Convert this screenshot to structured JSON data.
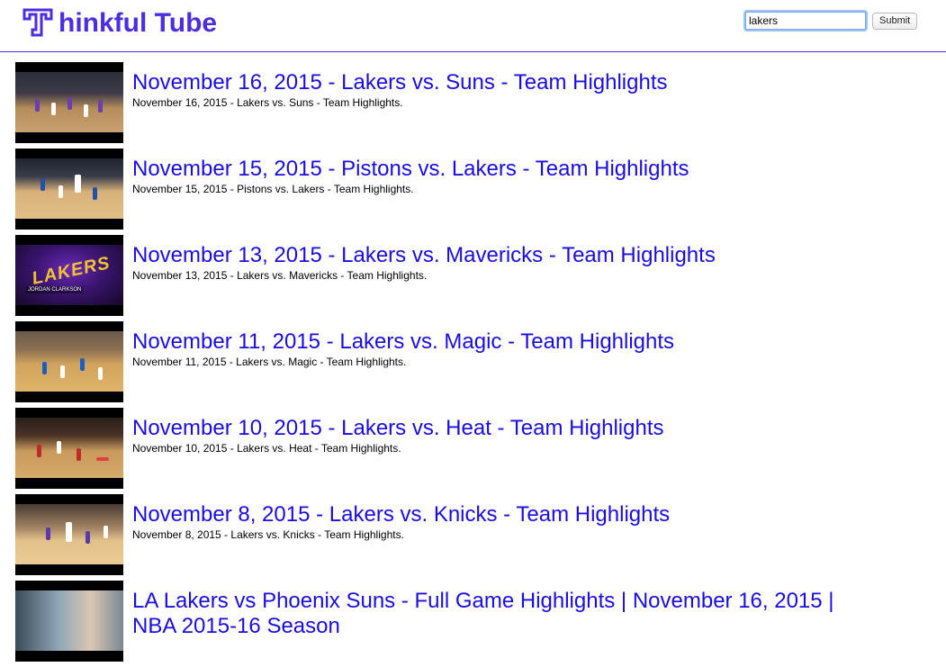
{
  "header": {
    "brand": "hinkful Tube",
    "logo_icon": "thinkful-t-logo-icon",
    "accent_color": "#4a2ee0"
  },
  "search": {
    "value": "lakers",
    "placeholder": "",
    "submit_label": "Submit"
  },
  "results": [
    {
      "title": "November 16, 2015 - Lakers vs. Suns - Team Highlights",
      "description": "November 16, 2015 - Lakers vs. Suns - Team Highlights."
    },
    {
      "title": "November 15, 2015 - Pistons vs. Lakers - Team Highlights",
      "description": "November 15, 2015 - Pistons vs. Lakers - Team Highlights."
    },
    {
      "title": "November 13, 2015 - Lakers vs. Mavericks - Team Highlights",
      "description": "November 13, 2015 - Lakers vs. Mavericks - Team Highlights.",
      "thumb_text": "LAKERS",
      "thumb_caption": "JORDAN CLARKSON"
    },
    {
      "title": "November 11, 2015 - Lakers vs. Magic - Team Highlights",
      "description": "November 11, 2015 - Lakers vs. Magic - Team Highlights."
    },
    {
      "title": "November 10, 2015 - Lakers vs. Heat - Team Highlights",
      "description": "November 10, 2015 - Lakers vs. Heat - Team Highlights."
    },
    {
      "title": "November 8, 2015 - Lakers vs. Knicks - Team Highlights",
      "description": "November 8, 2015 - Lakers vs. Knicks - Team Highlights."
    },
    {
      "title": "LA Lakers vs Phoenix Suns - Full Game Highlights | November 16, 2015 | NBA 2015-16 Season"
    }
  ]
}
